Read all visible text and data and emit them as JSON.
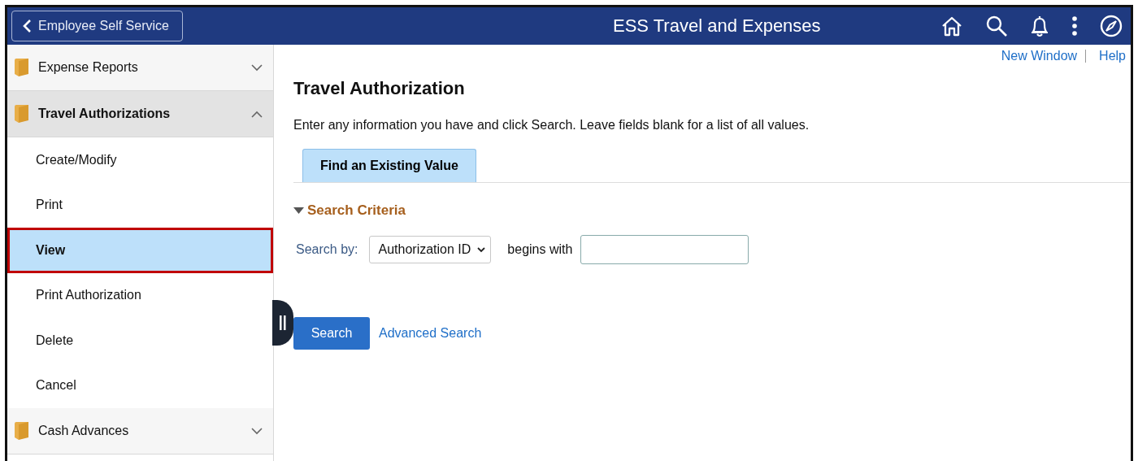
{
  "header": {
    "back_button": "Employee Self Service",
    "title": "ESS Travel and Expenses"
  },
  "sidebar": {
    "groups": [
      {
        "label": "Expense Reports",
        "expanded": false
      },
      {
        "label": "Travel Authorizations",
        "expanded": true,
        "items": [
          {
            "label": "Create/Modify",
            "selected": false,
            "highlighted": false
          },
          {
            "label": "Print",
            "selected": false,
            "highlighted": false
          },
          {
            "label": "View",
            "selected": true,
            "highlighted": true
          },
          {
            "label": "Print Authorization",
            "selected": false,
            "highlighted": false
          },
          {
            "label": "Delete",
            "selected": false,
            "highlighted": false
          },
          {
            "label": "Cancel",
            "selected": false,
            "highlighted": false
          }
        ]
      },
      {
        "label": "Cash Advances",
        "expanded": false
      }
    ]
  },
  "top_links": [
    "New Window",
    "Help"
  ],
  "page_title": "Travel Authorization",
  "instructions": "Enter any information you have and click Search. Leave fields blank for a list of all values.",
  "tabs": [
    {
      "label": "Find an Existing Value",
      "selected": true
    }
  ],
  "search_criteria": {
    "heading": "Search Criteria",
    "expanded": true,
    "search_by_label": "Search by:",
    "search_by_value": "Authorization ID",
    "operator": "begins with"
  },
  "buttons": {
    "search": "Search",
    "advanced": "Advanced Search"
  }
}
